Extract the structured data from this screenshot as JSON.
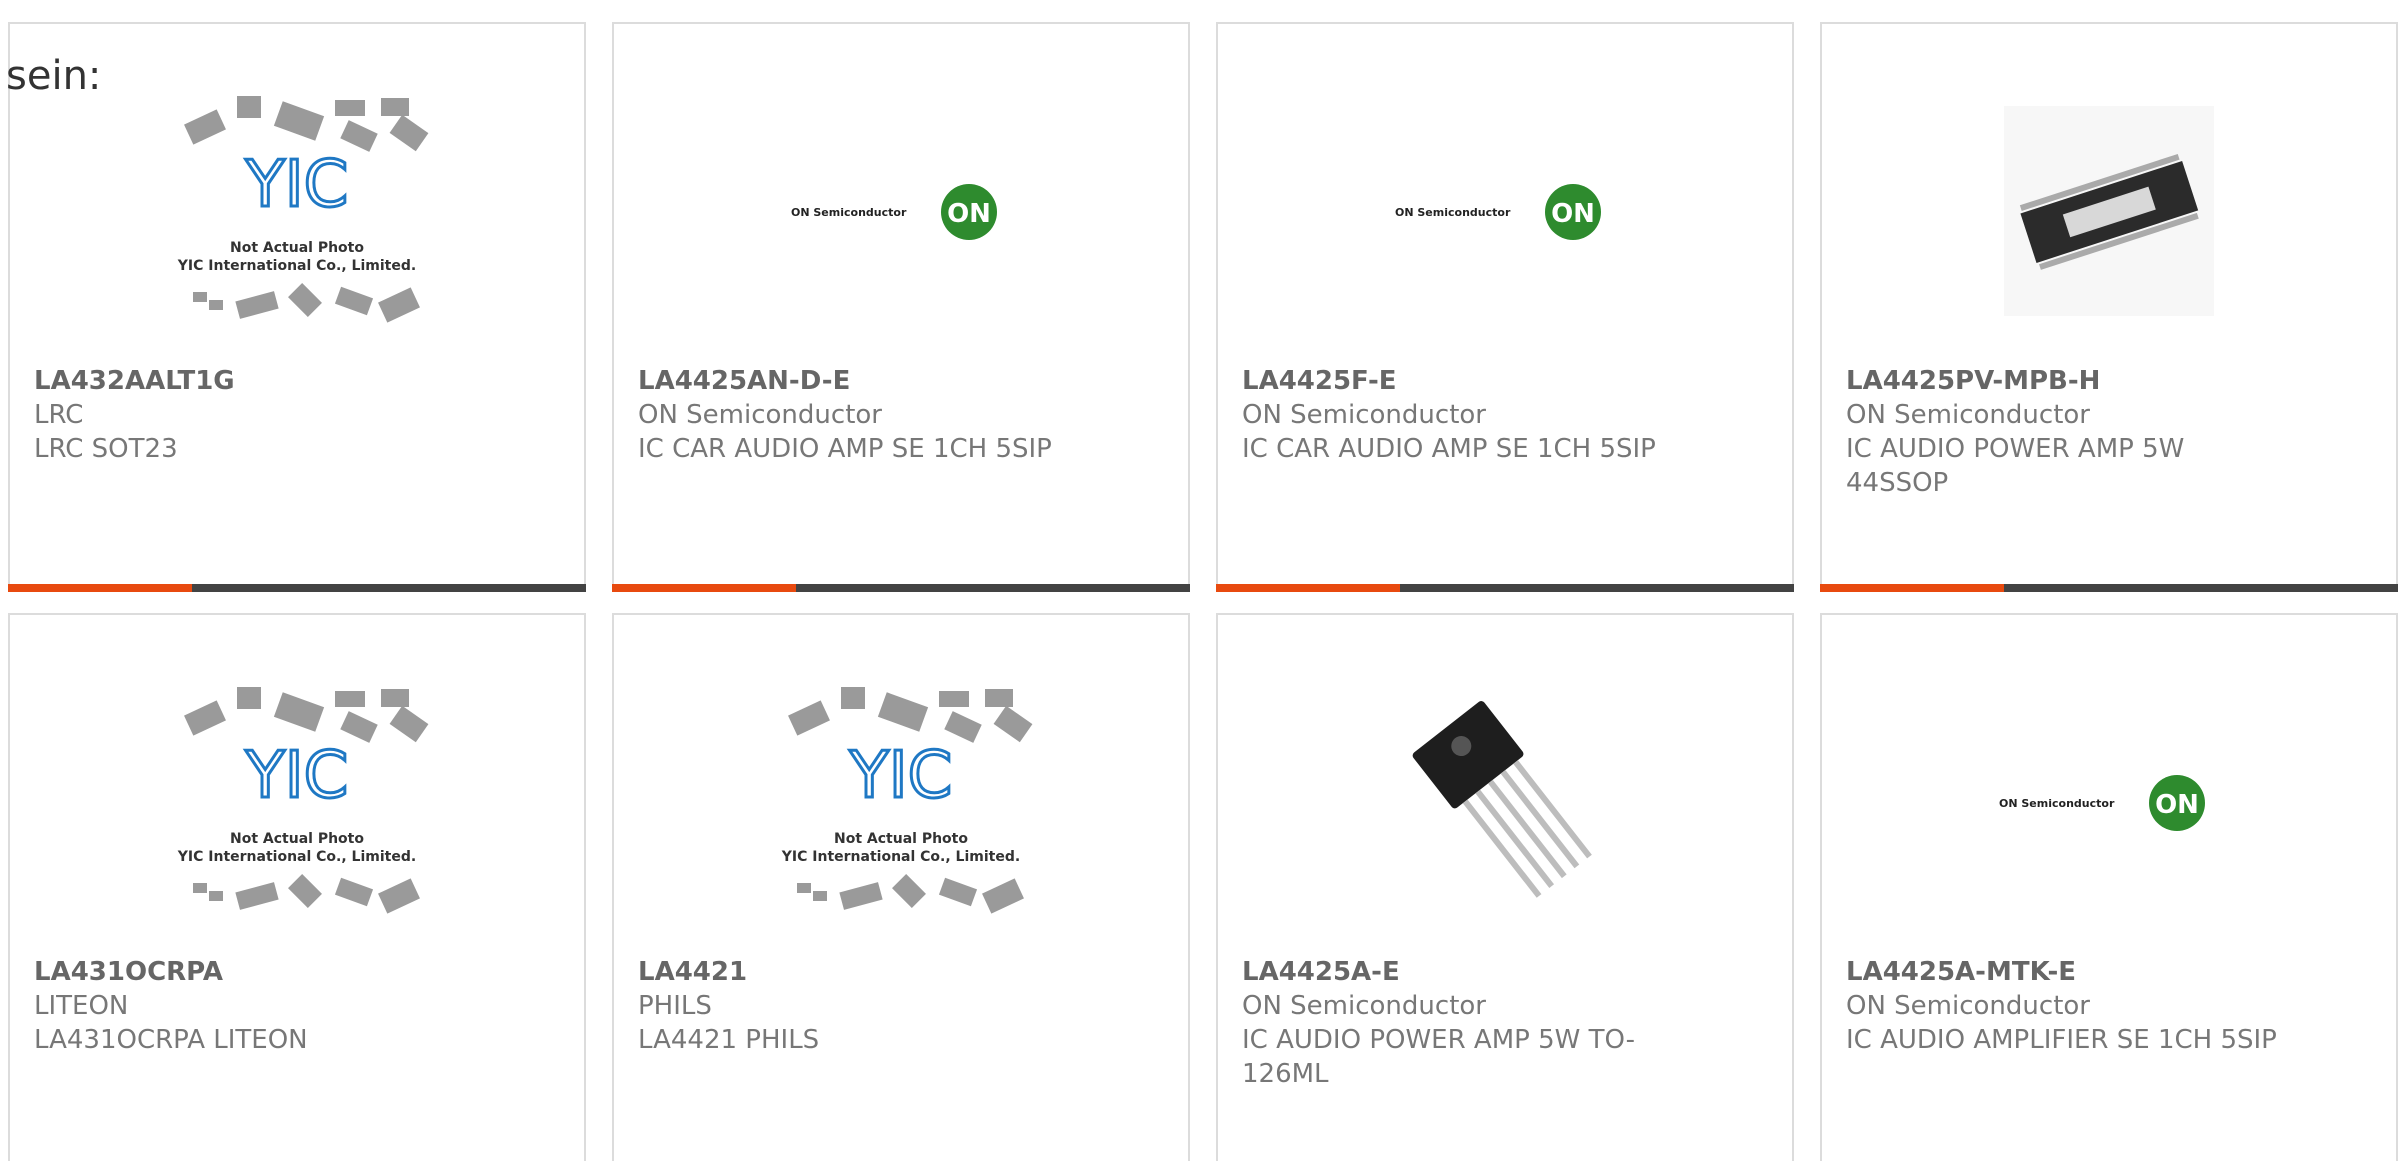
{
  "lead_text": "sein:",
  "colors": {
    "accent": "#e84a0f",
    "bar": "#434343",
    "border": "#dcdcdc",
    "text": "#777777",
    "yic_blue": "#1f78c4",
    "on_green": "#2e8b2e"
  },
  "placeholders": {
    "yic": {
      "line1": "Not Actual Photo",
      "line2": "YIC International Co., Limited.",
      "logo_text": "YIC"
    },
    "on": {
      "wordmark": "ON Semiconductor",
      "badge": "ON"
    }
  },
  "products": [
    {
      "part": "LA432AALT1G",
      "manufacturer": "LRC",
      "description": "LRC SOT23",
      "image": "yic-placeholder"
    },
    {
      "part": "LA4425AN-D-E",
      "manufacturer": "ON Semiconductor",
      "description": "IC CAR AUDIO AMP SE 1CH 5SIP",
      "image": "on-semi-logo"
    },
    {
      "part": "LA4425F-E",
      "manufacturer": "ON Semiconductor",
      "description": "IC CAR AUDIO AMP SE 1CH 5SIP",
      "image": "on-semi-logo"
    },
    {
      "part": "LA4425PV-MPB-H",
      "manufacturer": "ON Semiconductor",
      "description": "IC AUDIO POWER AMP 5W 44SSOP",
      "image": "ssop-chip-photo"
    },
    {
      "part": "LA431OCRPA",
      "manufacturer": "LITEON",
      "description": "LA431OCRPA LITEON",
      "image": "yic-placeholder"
    },
    {
      "part": "LA4421",
      "manufacturer": "PHILS",
      "description": "LA4421 PHILS",
      "image": "yic-placeholder"
    },
    {
      "part": "LA4425A-E",
      "manufacturer": "ON Semiconductor",
      "description": "IC AUDIO POWER AMP 5W TO-126ML",
      "image": "to126-transistor-photo"
    },
    {
      "part": "LA4425A-MTK-E",
      "manufacturer": "ON Semiconductor",
      "description": "IC AUDIO AMPLIFIER SE 1CH 5SIP",
      "image": "on-semi-logo"
    }
  ]
}
